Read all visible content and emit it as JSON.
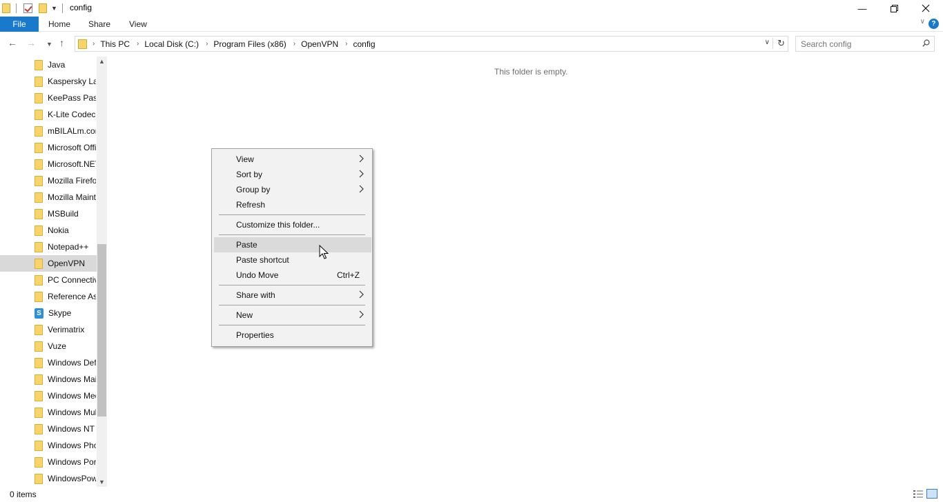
{
  "window": {
    "title": "config",
    "controls": [
      "minimize",
      "restore",
      "close"
    ]
  },
  "ribbon": {
    "file_tab": "File",
    "tabs": [
      "Home",
      "Share",
      "View"
    ]
  },
  "address_bar": {
    "crumbs": [
      "This PC",
      "Local Disk (C:)",
      "Program Files (x86)",
      "OpenVPN",
      "config"
    ]
  },
  "search": {
    "placeholder": "Search config"
  },
  "nav_pane": {
    "items": [
      {
        "label": "Java",
        "icon": "folder-icon"
      },
      {
        "label": "Kaspersky Lab",
        "icon": "folder-icon"
      },
      {
        "label": "KeePass Password Safe",
        "icon": "folder-icon"
      },
      {
        "label": "K-Lite Codec Pack",
        "icon": "folder-icon"
      },
      {
        "label": "mBILALm.com",
        "icon": "folder-icon"
      },
      {
        "label": "Microsoft Office",
        "icon": "folder-icon"
      },
      {
        "label": "Microsoft.NET",
        "icon": "folder-icon"
      },
      {
        "label": "Mozilla Firefox",
        "icon": "folder-icon"
      },
      {
        "label": "Mozilla Maintenance Service",
        "icon": "folder-icon"
      },
      {
        "label": "MSBuild",
        "icon": "folder-icon"
      },
      {
        "label": "Nokia",
        "icon": "folder-icon"
      },
      {
        "label": "Notepad++",
        "icon": "folder-icon"
      },
      {
        "label": "OpenVPN",
        "icon": "folder-icon",
        "selected": true
      },
      {
        "label": "PC Connectivity Solution",
        "icon": "folder-icon"
      },
      {
        "label": "Reference Assemblies",
        "icon": "folder-icon"
      },
      {
        "label": "Skype",
        "icon": "skype-icon"
      },
      {
        "label": "Verimatrix",
        "icon": "folder-icon"
      },
      {
        "label": "Vuze",
        "icon": "folder-icon"
      },
      {
        "label": "Windows Defender",
        "icon": "folder-icon"
      },
      {
        "label": "Windows Mail",
        "icon": "folder-icon"
      },
      {
        "label": "Windows Media Player",
        "icon": "folder-icon"
      },
      {
        "label": "Windows Multimedia Platform",
        "icon": "folder-icon"
      },
      {
        "label": "Windows NT",
        "icon": "folder-icon"
      },
      {
        "label": "Windows Photo Viewer",
        "icon": "folder-icon"
      },
      {
        "label": "Windows Portable Devices",
        "icon": "folder-icon"
      },
      {
        "label": "WindowsPowerShell",
        "icon": "folder-icon"
      }
    ]
  },
  "content": {
    "empty_message": "This folder is empty."
  },
  "context_menu": {
    "view": "View",
    "sort_by": "Sort by",
    "group_by": "Group by",
    "refresh": "Refresh",
    "customize": "Customize this folder...",
    "paste": "Paste",
    "paste_shortcut": "Paste shortcut",
    "undo_move": "Undo Move",
    "undo_shortcut": "Ctrl+Z",
    "share_with": "Share with",
    "new": "New",
    "properties": "Properties",
    "highlighted_item": "Paste"
  },
  "status_bar": {
    "item_count": "0 items"
  },
  "colors": {
    "accent": "#1979ca",
    "folder": "#f7d56a",
    "selection": "#d9d9d9",
    "menu_bg": "#f2f2f2"
  }
}
